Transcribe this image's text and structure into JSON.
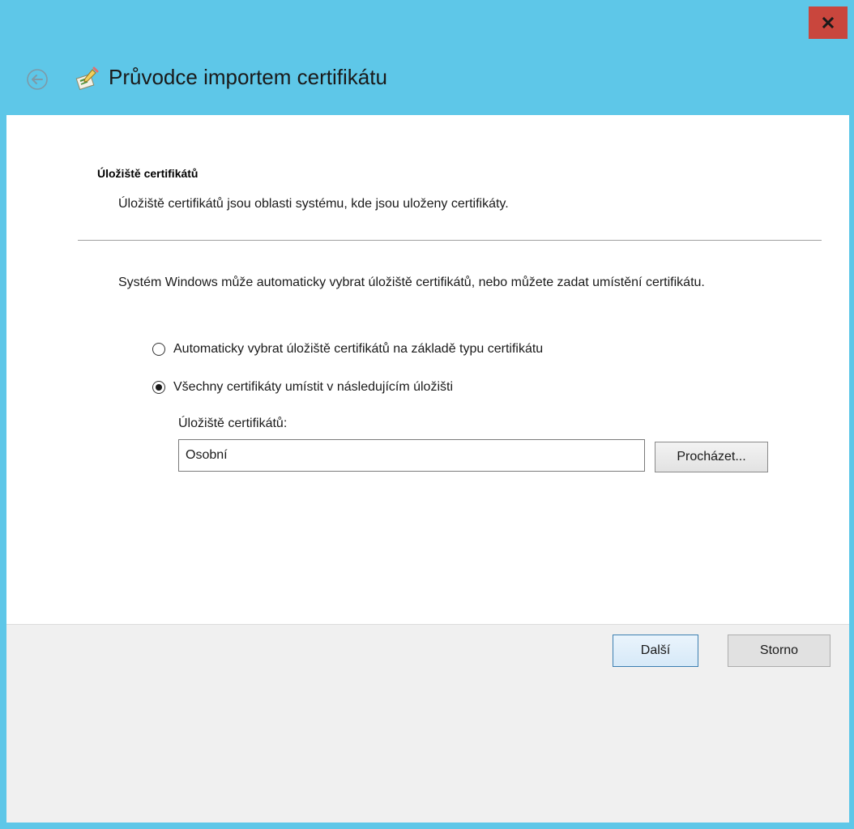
{
  "window": {
    "title": "Průvodce importem certifikátu",
    "frame_color": "#5ec7e8",
    "close_button_color": "#c9463d"
  },
  "icons": {
    "close": "close-icon",
    "back": "back-arrow-icon",
    "wizard": "certificate-wizard-icon"
  },
  "page": {
    "heading": "Úložiště certifikátů",
    "description": "Úložiště certifikátů jsou oblasti systému, kde jsou uloženy certifikáty.",
    "intro": "Systém Windows může automaticky vybrat úložiště certifikátů, nebo můžete zadat umístění certifikátu."
  },
  "options": {
    "auto_label": "Automaticky vybrat úložiště certifikátů na základě typu certifikátu",
    "auto_checked": false,
    "manual_label": "Všechny certifikáty umístit v následujícím úložišti",
    "manual_checked": true
  },
  "store": {
    "label": "Úložiště certifikátů:",
    "value": "Osobní",
    "browse_label": "Procházet..."
  },
  "footer": {
    "next_label": "Další",
    "cancel_label": "Storno"
  }
}
